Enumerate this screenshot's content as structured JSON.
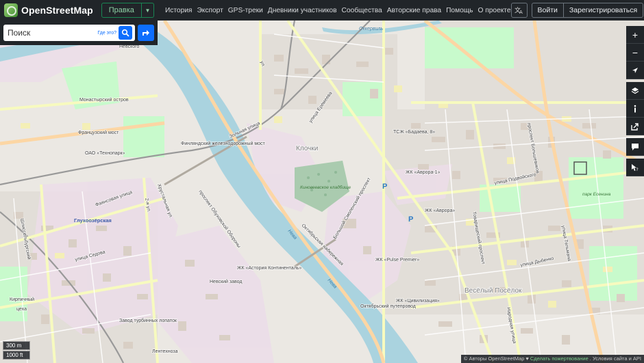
{
  "header": {
    "logo_text": "OpenStreetMap",
    "edit_label": "Правка",
    "nav": [
      "История",
      "Экспорт",
      "GPS-треки",
      "Дневники участников",
      "Сообщества",
      "Авторские права",
      "Помощь",
      "О проекте"
    ],
    "login_label": "Войти",
    "signup_label": "Зарегистрироваться"
  },
  "search": {
    "placeholder": "Поиск",
    "where_is_label": "Где это?"
  },
  "map_labels": {
    "nevsky_top": "Невского",
    "monastyrsky": "Монастырский остров",
    "frantsuzsky": "Французский мост",
    "tekhnopark": "ОАО «Технопарк»",
    "finlyandsky": "Финляндский железнодорожный мост",
    "klochki": "Клочки",
    "kinoveevskoe": "Киновеевское кладбище",
    "glukhoozerskaya": "Глухоозёрская",
    "zhk_avrora1": "ЖК «Аврора-1»",
    "zhk_avrora": "ЖК «Аврора»",
    "tszh": "ТСЖ «Бадаева, 8»",
    "astoria": "ЖК «Астория Континенталь»",
    "pulse": "ЖК «Pulse Premier»",
    "nevsky_zavod": "Невский завод",
    "zavod_turbinnykh": "Завод турбинных лопаток",
    "oktyabrsky": "Октябрьский путепровод",
    "tsivilizatsiya": "ЖК «Цивилизация»",
    "vesely": "Весёлый Посёлок",
    "park_esenina": "парк Есенина",
    "neva_1": "Нева",
    "neva_2": "Нева",
    "okkervil": "Оккервиль",
    "st_zolnaya": "Зольная улица",
    "st_yeremeeva": "улица Ерёмеева",
    "st_sedova": "улица Седова",
    "st_podvoyskogo": "улица Подвойского",
    "st_dybenko": "улица Дыбенко",
    "st_bolshevikov": "проспект Большевиков",
    "st_bolshoy_smolensky": "Большой Смоленский проспект",
    "st_oktyabrskaya": "Октябрьская набережная",
    "st_obukhovskoy": "проспект Обуховской Обороны",
    "st_tovarishchesky": "Товарищеский проспект",
    "st_narodnaya": "Народная улица",
    "st_fayansovaya": "Фаянсовая улица",
    "st_shlisselburgsky": "Шлиссельбургский",
    "st_khrustalnaya": "Хрустальная ул.",
    "st_telman": "улица Тельмана",
    "st_2ya_luch": "2-я ул.",
    "kirpichny": "Кирпичный",
    "lentekhnoza": "Лентехноза",
    "tseha": "цеха",
    "parking_1": "P",
    "parking_2": "P",
    "ul_label": "ул."
  },
  "controls": {
    "zoom_in": "+",
    "zoom_out": "−"
  },
  "scale": {
    "metric": "300 m",
    "imperial": "1000 ft"
  },
  "attribution": {
    "authors": "© Авторы OpenStreetMap",
    "heart": "♥",
    "donate": "Сделать пожертвование",
    "terms": ". Условия сайта и API"
  },
  "colors": {
    "header_bg": "#212529",
    "water": "#aad3df",
    "land": "#f2efe9",
    "residential": "#e0dfdf",
    "building": "#d9d0c9",
    "park": "#c8facc",
    "industrial": "#ebdbe8",
    "primary_road": "#fcd6a4",
    "secondary_road": "#f7fabf",
    "accent_blue": "#0d6efd",
    "edit_green": "#198754"
  },
  "icons": [
    "osm-logo-icon",
    "caret-down-icon",
    "translate-icon",
    "search-icon",
    "directions-icon",
    "zoom-in-icon",
    "zoom-out-icon",
    "locate-icon",
    "layers-icon",
    "info-icon",
    "share-icon",
    "note-icon",
    "query-icon"
  ]
}
